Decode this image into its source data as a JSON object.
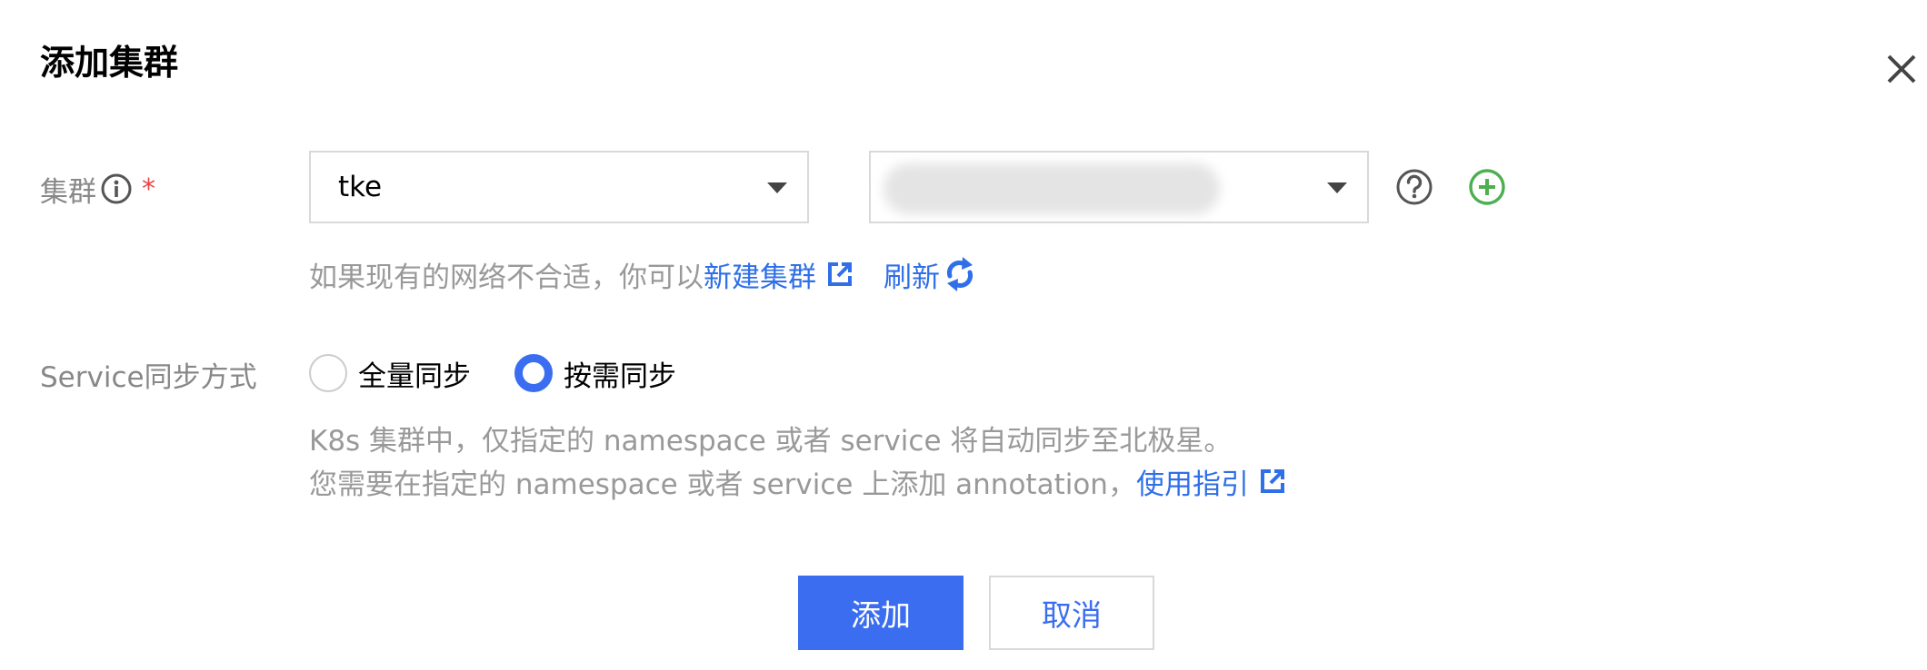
{
  "dialog": {
    "title": "添加集群",
    "close_icon": "close-icon"
  },
  "cluster": {
    "label": "集群",
    "required_mark": "*",
    "type_select_value": "tke",
    "id_select_value": "",
    "hint_text": "如果现有的网络不合适，你可以",
    "create_link": "新建集群",
    "refresh_link": "刷新"
  },
  "sync": {
    "label": "Service同步方式",
    "options": [
      {
        "label": "全量同步",
        "checked": false
      },
      {
        "label": "按需同步",
        "checked": true
      }
    ],
    "hint_line1": "K8s 集群中，仅指定的 namespace 或者 service 将自动同步至北极星。",
    "hint_line2": "您需要在指定的 namespace 或者 service 上添加 annotation，",
    "guide_link": "使用指引"
  },
  "buttons": {
    "add_label": "添加",
    "cancel_label": "取消"
  },
  "colors": {
    "primary": "#3a6df0",
    "link": "#2f6fe8",
    "required": "#e54545",
    "add_icon": "#4caf50"
  }
}
